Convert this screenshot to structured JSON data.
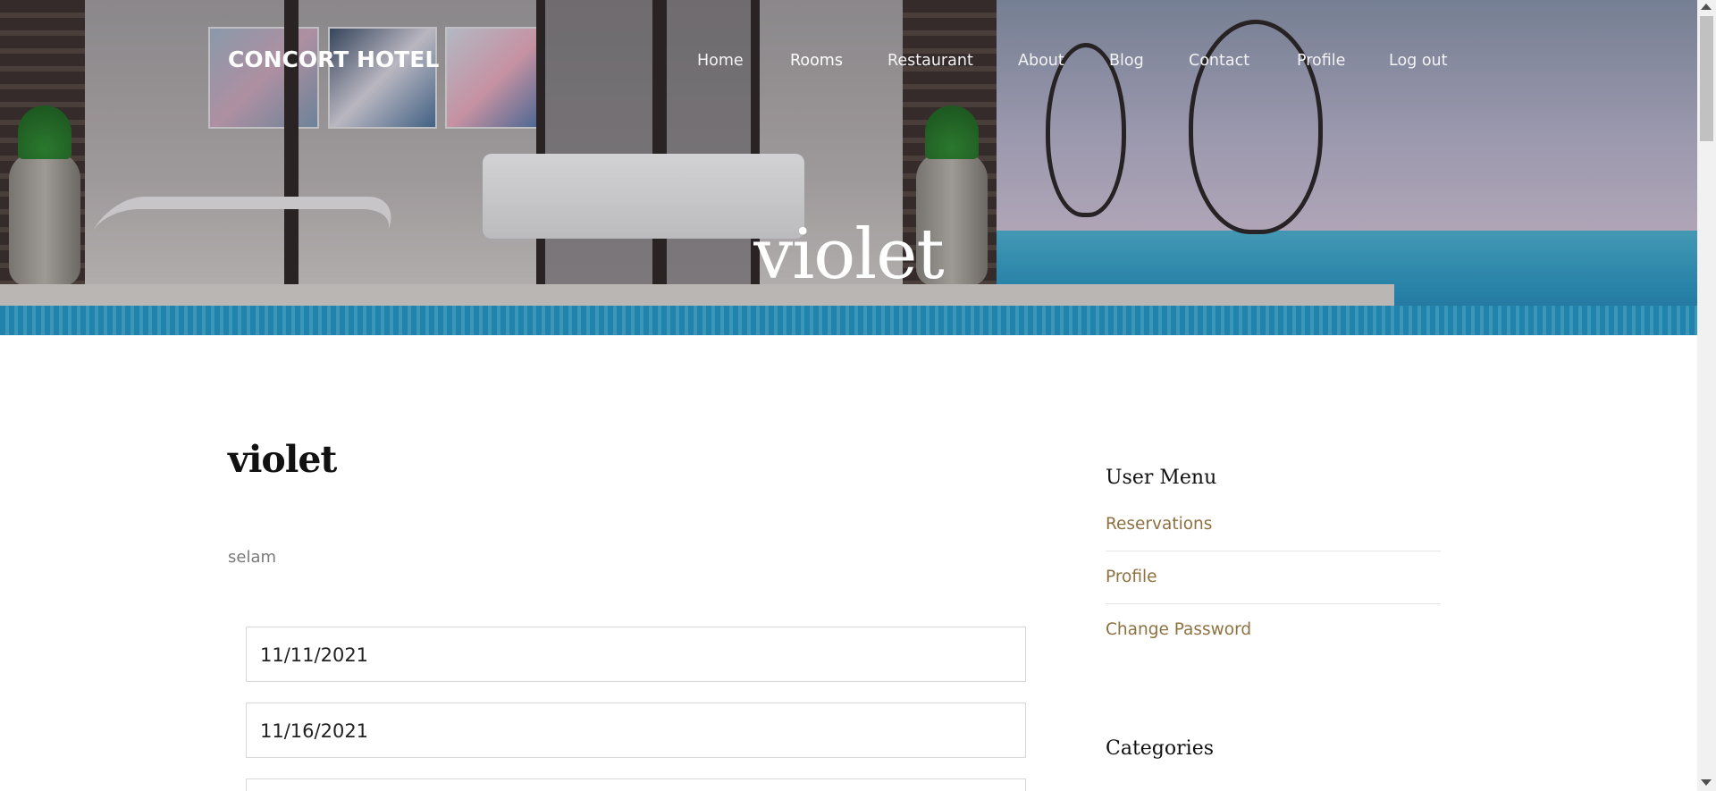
{
  "header": {
    "brand": "CONCORT HOTEL",
    "nav": [
      {
        "label": "Home",
        "active": false
      },
      {
        "label": "Rooms",
        "active": true
      },
      {
        "label": "Restaurant",
        "active": false
      },
      {
        "label": "About",
        "active": false
      },
      {
        "label": "Blog",
        "active": false
      },
      {
        "label": "Contact",
        "active": false
      },
      {
        "label": "Profile",
        "active": false
      },
      {
        "label": "Log out",
        "active": false
      }
    ],
    "hero_title": "violet"
  },
  "main": {
    "title": "violet",
    "description": "selam",
    "fields": [
      {
        "value": "11/11/2021"
      },
      {
        "value": "11/16/2021"
      }
    ]
  },
  "sidebar": {
    "user_menu_heading": "User Menu",
    "user_menu_items": [
      {
        "label": "Reservations"
      },
      {
        "label": "Profile"
      },
      {
        "label": "Change Password"
      }
    ],
    "categories_heading": "Categories"
  },
  "colors": {
    "link_accent": "#8d7140",
    "nav_text": "#f3f3f3"
  }
}
